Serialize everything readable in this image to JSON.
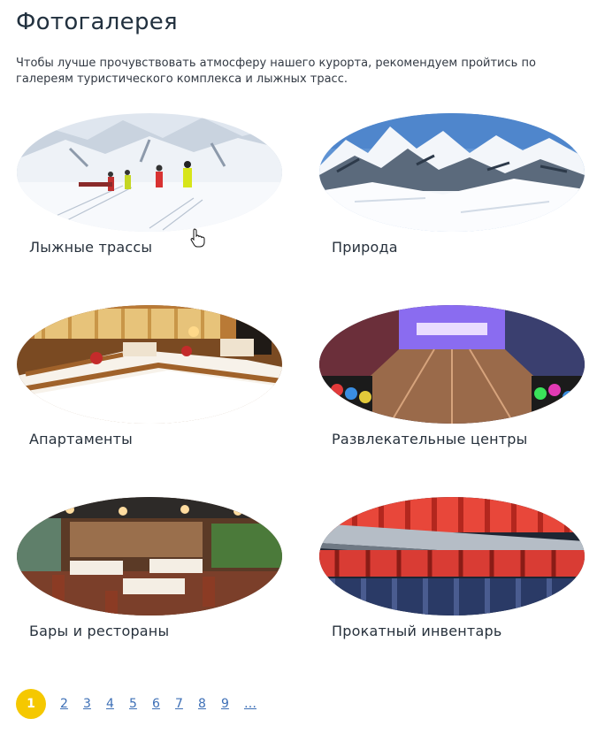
{
  "page": {
    "title": "Фотогалерея",
    "intro": "Чтобы лучше прочувствовать атмосферу нашего курорта, рекомендуем пройтись по галереям туристического комплекса и лыжных трасс."
  },
  "gallery": {
    "items": [
      {
        "label": "Лыжные трассы",
        "image": "ski-slopes-photo"
      },
      {
        "label": "Природа",
        "image": "mountains-photo"
      },
      {
        "label": "Апартаменты",
        "image": "hotel-room-photo"
      },
      {
        "label": "Развлекательные центры",
        "image": "bowling-photo"
      },
      {
        "label": "Бары и рестораны",
        "image": "restaurant-photo"
      },
      {
        "label": "Прокатный инвентарь",
        "image": "ski-boots-photo"
      }
    ]
  },
  "pagination": {
    "current": "1",
    "pages": [
      "2",
      "3",
      "4",
      "5",
      "6",
      "7",
      "8",
      "9"
    ],
    "more": "…"
  },
  "colors": {
    "accent": "#f5c800",
    "link": "#3d6fb6",
    "heading": "#22313f"
  }
}
